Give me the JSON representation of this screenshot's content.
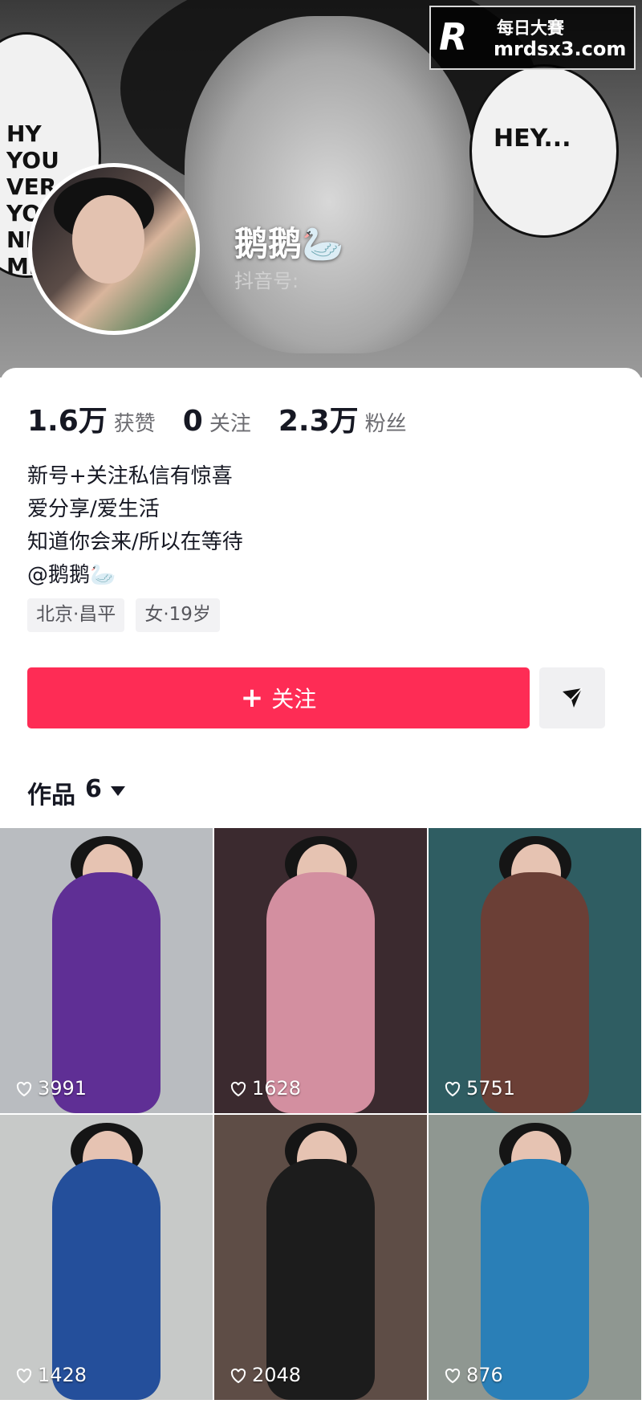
{
  "header": {
    "bubble_left_text": "HY\nYOU\nVER\nYOU\nND\nME",
    "bubble_right_text": "HEY...",
    "watermark": {
      "logo": "R",
      "title": "每日大賽",
      "url": "mrdsx3.com"
    }
  },
  "profile": {
    "nickname": "鹅鹅🦢",
    "douyin_id_label": "抖音号:"
  },
  "stats": [
    {
      "value": "1.6万",
      "label": "获赞"
    },
    {
      "value": "0",
      "label": "关注"
    },
    {
      "value": "2.3万",
      "label": "粉丝"
    }
  ],
  "bio_lines": [
    "新号+关注私信有惊喜",
    "爱分享/爱生活",
    "知道你会来/所以在等待",
    "@鹅鹅🦢"
  ],
  "tags": [
    "北京·昌平",
    "女·19岁"
  ],
  "actions": {
    "follow_label": "关注",
    "share_icon": "send-icon"
  },
  "works": {
    "title": "作品",
    "count": "6",
    "items": [
      {
        "likes": "3991",
        "background": "#b9bcc0",
        "outfit": "#5f2f95"
      },
      {
        "likes": "1628",
        "background": "#3b2a2f",
        "outfit": "#d38fa0"
      },
      {
        "likes": "5751",
        "background": "#2f5d62",
        "outfit": "#6b3f36"
      },
      {
        "likes": "1428",
        "background": "#c7c9c8",
        "outfit": "#244f9b"
      },
      {
        "likes": "2048",
        "background": "#5e4d46",
        "outfit": "#1c1c1c"
      },
      {
        "likes": "876",
        "background": "#8f9791",
        "outfit": "#2a7fb7"
      }
    ]
  },
  "colors": {
    "accent": "#fe2c55",
    "text": "#161823",
    "muted": "#6d6d72",
    "tag_background": "#f2f2f4"
  }
}
